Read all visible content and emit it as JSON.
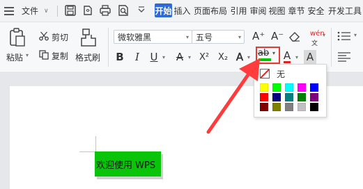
{
  "menubar": {
    "file_label": "文件",
    "tabs": [
      {
        "label": "开始",
        "active": true
      },
      {
        "label": "插入",
        "active": false
      },
      {
        "label": "页面布局",
        "active": false
      },
      {
        "label": "引用",
        "active": false
      },
      {
        "label": "审阅",
        "active": false
      },
      {
        "label": "视图",
        "active": false
      },
      {
        "label": "章节",
        "active": false
      },
      {
        "label": "安全",
        "active": false
      },
      {
        "label": "开发工具",
        "active": false
      }
    ]
  },
  "ribbon": {
    "paste_label": "粘贴",
    "cut_label": "剪切",
    "copy_label": "复制",
    "format_painter_label": "格式刷",
    "font_name": "微软雅黑",
    "font_size": "五号",
    "phonetic_label": "wén",
    "bold": "B",
    "italic": "I",
    "underline": "U",
    "strike": "A",
    "superscript": "X²",
    "subscript": "X₂",
    "text_effect": "A",
    "highlight": "ab",
    "font_color": "A",
    "char_shading": "A",
    "grow_font": "A⁺",
    "shrink_font": "A⁻"
  },
  "color_menu": {
    "none_label": "无",
    "colors": [
      [
        "#ffff00",
        "#00ff00",
        "#00ffff",
        "#ff00ff",
        "#0000ff"
      ],
      [
        "#ff0000",
        "#000080",
        "#008080",
        "#008000",
        "#800080"
      ],
      [
        "#800000",
        "#808000",
        "#808080",
        "#c0c0c0",
        "#000000"
      ]
    ]
  },
  "document": {
    "sample_text": "欢迎使用 WPS",
    "highlight_color": "#0ac40a"
  },
  "annotation": {
    "arrow_color": "#ff3b3b",
    "highlight_box_color": "#e53935"
  }
}
